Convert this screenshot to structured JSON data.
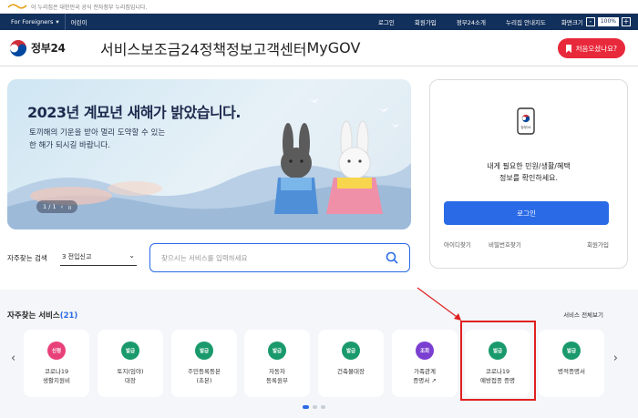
{
  "gov_strip": {
    "text": "이 누리집은 대한민국 공식 전자정부 누리집입니다."
  },
  "util_bar": {
    "left": [
      "For Foreigners",
      "어린이"
    ],
    "right": [
      "로그인",
      "회원가입",
      "정부24소개",
      "누리집 안내지도"
    ],
    "zoom_label": "화면크기",
    "zoom_minus": "-",
    "zoom_value": "100%",
    "zoom_plus": "+"
  },
  "header": {
    "logo_text": "정부24",
    "nav": [
      "서비스",
      "보조금24",
      "정책정보",
      "고객센터",
      "MyGOV"
    ],
    "cta": "처음오셨나요?"
  },
  "hero": {
    "title": "2023년 계묘년 새해가 밝았습니다.",
    "desc_line1": "토끼해의 기운을 받아 멀리 도약할 수 있는",
    "desc_line2": "한 해가 되시길 바랍니다.",
    "pager": "1 / 1",
    "prev": "‹",
    "pause": "॥"
  },
  "login_card": {
    "phone_label": "정부24",
    "msg_line1": "내게 필요한 민원/생활/혜택",
    "msg_line2": "정보를 확인하세요.",
    "login_button": "로그인",
    "find_id": "아이디찾기",
    "find_pw": "비밀번호찾기",
    "signup": "회원가입"
  },
  "search": {
    "label": "자주찾는 검색",
    "selected": "3 전입신고",
    "placeholder": "찾으시는 서비스를 입력하세요"
  },
  "freq": {
    "title": "자주찾는 서비스",
    "count": "(21)",
    "view_all": "서비스 전체보기",
    "arrow_left": "‹",
    "arrow_right": "›",
    "cards": [
      {
        "badge": "신청",
        "color": "#e8417a",
        "line1": "코로나19",
        "line2": "생활지원비"
      },
      {
        "badge": "발급",
        "color": "#1a9a6c",
        "line1": "토지(임야)",
        "line2": "대장"
      },
      {
        "badge": "발급",
        "color": "#1a9a6c",
        "line1": "주민등록등본",
        "line2": "(초본)"
      },
      {
        "badge": "발급",
        "color": "#1a9a6c",
        "line1": "자동차",
        "line2": "등록원부"
      },
      {
        "badge": "발급",
        "color": "#1a9a6c",
        "line1": "건축물대장",
        "line2": ""
      },
      {
        "badge": "조회",
        "color": "#7a3fd0",
        "line1": "가족관계",
        "line2": "증명서 ↗"
      },
      {
        "badge": "발급",
        "color": "#1a9a6c",
        "line1": "코로나19",
        "line2": "예방접종 증명"
      },
      {
        "badge": "발급",
        "color": "#1a9a6c",
        "line1": "병적증명서",
        "line2": ""
      }
    ]
  }
}
